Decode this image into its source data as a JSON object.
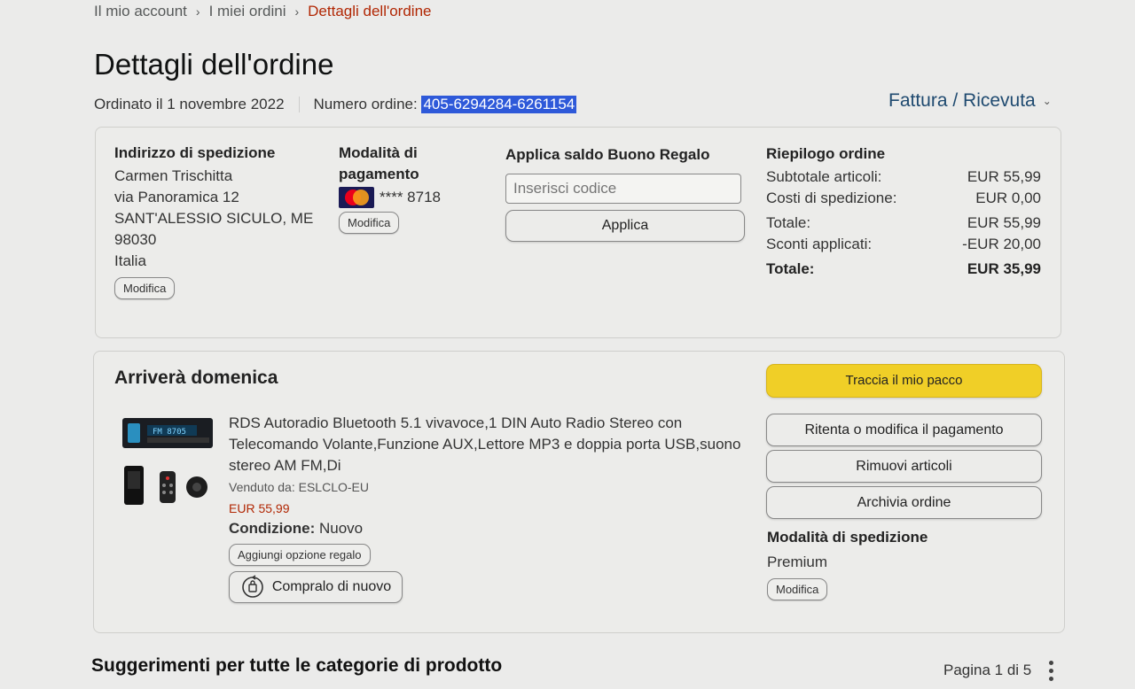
{
  "breadcrumb": [
    "Il mio account",
    "I miei ordini",
    "Dettagli dell'ordine"
  ],
  "page_title": "Dettagli dell'ordine",
  "order_meta": {
    "date": "Ordinato il 1 novembre 2022",
    "number_label": "Numero ordine:",
    "number": "405-6294284-6261154"
  },
  "invoice_label": "Fattura / Ricevuta",
  "shipping": {
    "heading": "Indirizzo di spedizione",
    "lines": [
      "Carmen Trischitta",
      "via Panoramica 12",
      "SANT'ALESSIO SICULO, ME",
      "98030",
      "Italia"
    ],
    "edit": "Modifica"
  },
  "payment": {
    "heading_1": "Modalità di",
    "heading_2": "pagamento",
    "card": "**** 8718",
    "edit": "Modifica"
  },
  "gift": {
    "heading": "Applica saldo Buono Regalo",
    "placeholder": "Inserisci codice",
    "apply": "Applica"
  },
  "summary": {
    "heading": "Riepilogo ordine",
    "rows": [
      {
        "label": "Subtotale articoli:",
        "value": "EUR 55,99"
      },
      {
        "label": "Costi di spedizione:",
        "value": "EUR 0,00"
      },
      {
        "label": "Totale:",
        "value": "EUR 55,99"
      },
      {
        "label": "Sconti applicati:",
        "value": "-EUR 20,00"
      },
      {
        "label": "Totale:",
        "value": "EUR 35,99"
      }
    ]
  },
  "delivery": {
    "heading": "Arriverà domenica",
    "product_title_1": "RDS Autoradio Bluetooth 5.1 vivavoce,1 DIN Auto Radio Stereo con",
    "product_title_2": "Telecomando Volante,Funzione AUX,Lettore MP3 e doppia porta USB,suono",
    "product_title_3": "stereo AM FM,Di",
    "seller": "Venduto da: ESLCLO-EU",
    "price": "EUR 55,99",
    "condition_label": "Condizione:",
    "condition_value": "Nuovo",
    "gift_option": "Aggiungi opzione regalo",
    "buy_again": "Compralo di nuovo"
  },
  "actions": {
    "track": "Traccia il mio pacco",
    "retry_payment": "Ritenta o modifica il pagamento",
    "remove": "Rimuovi articoli",
    "archive": "Archivia ordine"
  },
  "shipping_method": {
    "heading": "Modalità di spedizione",
    "value": "Premium",
    "edit": "Modifica"
  },
  "suggestions": {
    "title": "Suggerimenti per tutte le categorie di prodotto",
    "page": "Pagina 1 di 5"
  },
  "colors": {
    "accent_yellow": "#f0cf27",
    "price_red": "#b12704",
    "link_blue": "#1f4a70",
    "highlight_blue": "#2e59d9"
  }
}
